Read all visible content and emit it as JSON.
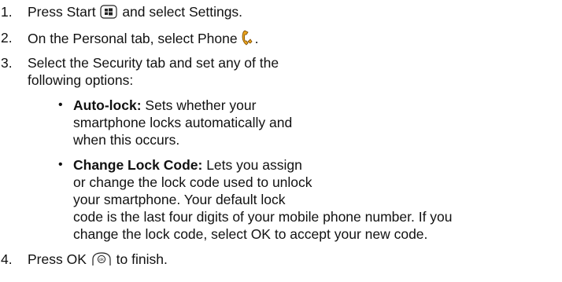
{
  "steps": [
    {
      "number": "1.",
      "before_icon": "Press Start",
      "icon": "windows-start-icon",
      "after_icon": "and select Settings."
    },
    {
      "number": "2.",
      "before_icon": "On the Personal tab, select Phone",
      "icon": "phone-icon",
      "after_icon": "."
    },
    {
      "number": "3.",
      "lines": [
        "Select the Security tab and set any of the",
        "following options:"
      ],
      "options": [
        {
          "label": "Auto-lock:",
          "lines": [
            "Sets whether your",
            "smartphone locks automatically and",
            "when this occurs."
          ]
        },
        {
          "label": "Change Lock Code:",
          "lines": [
            "Lets you assign",
            "or change the lock code used to unlock",
            "your smartphone. Your default lock",
            "code is the last four digits of your mobile phone number. If you",
            "change the lock code, select OK to accept your new code."
          ]
        }
      ]
    },
    {
      "number": "4.",
      "before_icon": "Press OK",
      "icon": "ok-button-icon",
      "after_icon": "to finish."
    }
  ]
}
